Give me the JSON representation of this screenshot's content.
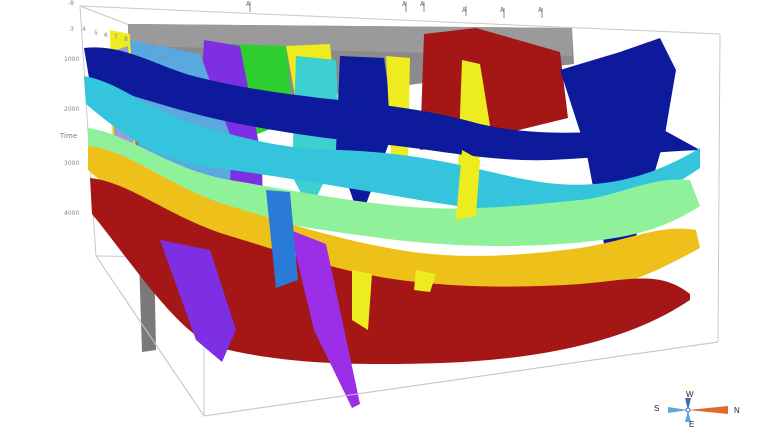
{
  "viewer": {
    "time_axis_label": "Time",
    "time_ticks": [
      "1000",
      "2000",
      "3000",
      "4000"
    ],
    "top_ticks": [
      "-8",
      "3",
      "4",
      "5",
      "6",
      "7",
      "8"
    ],
    "section_ticks": [
      "10",
      "11"
    ],
    "wells": [
      "A",
      "A",
      "A",
      "A",
      "A",
      "A"
    ]
  },
  "compass": {
    "north": "N",
    "south": "S",
    "east": "E",
    "west": "W"
  },
  "colors": {
    "horizon_blue": "#0d1a9c",
    "horizon_cyan": "#34c4dc",
    "horizon_green": "#8ff29a",
    "horizon_yellow": "#eec11a",
    "horizon_red": "#a51616",
    "seismic_gray": "#8b8b8b",
    "fault_purple": "#7f2fe3",
    "fault_violet": "#9b2ee6",
    "fault_yellow": "#ecec1e",
    "fault_lightblue": "#5aa8e0"
  }
}
